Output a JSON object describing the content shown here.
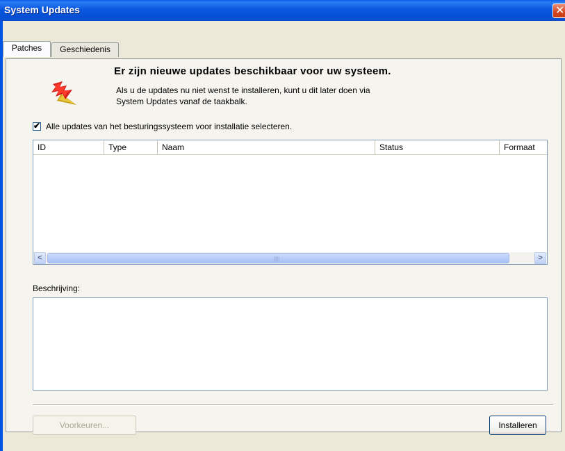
{
  "window": {
    "title": "System Updates"
  },
  "tabs": [
    {
      "label": "Patches"
    },
    {
      "label": "Geschiedenis"
    }
  ],
  "header": {
    "heading": "Er zijn nieuwe updates beschikbaar voor uw systeem.",
    "line1": "Als u de updates nu niet wenst te installeren, kunt u dit later doen via",
    "line2": "System Updates vanaf de taakbalk."
  },
  "select_all": {
    "label": "Alle updates van het besturingssysteem voor installatie selecteren.",
    "checked": true
  },
  "table": {
    "columns": [
      "ID",
      "Type",
      "Naam",
      "Status",
      "Formaat"
    ],
    "rows": []
  },
  "description": {
    "label": "Beschrijving:",
    "value": ""
  },
  "buttons": {
    "preferences": "Voorkeuren...",
    "install": "Installeren"
  },
  "icons": {
    "close": "close-icon",
    "update": "update-flag-icon",
    "checkmark": "checkmark-icon",
    "scroll_left": "arrow-left-icon",
    "scroll_right": "arrow-right-icon"
  }
}
